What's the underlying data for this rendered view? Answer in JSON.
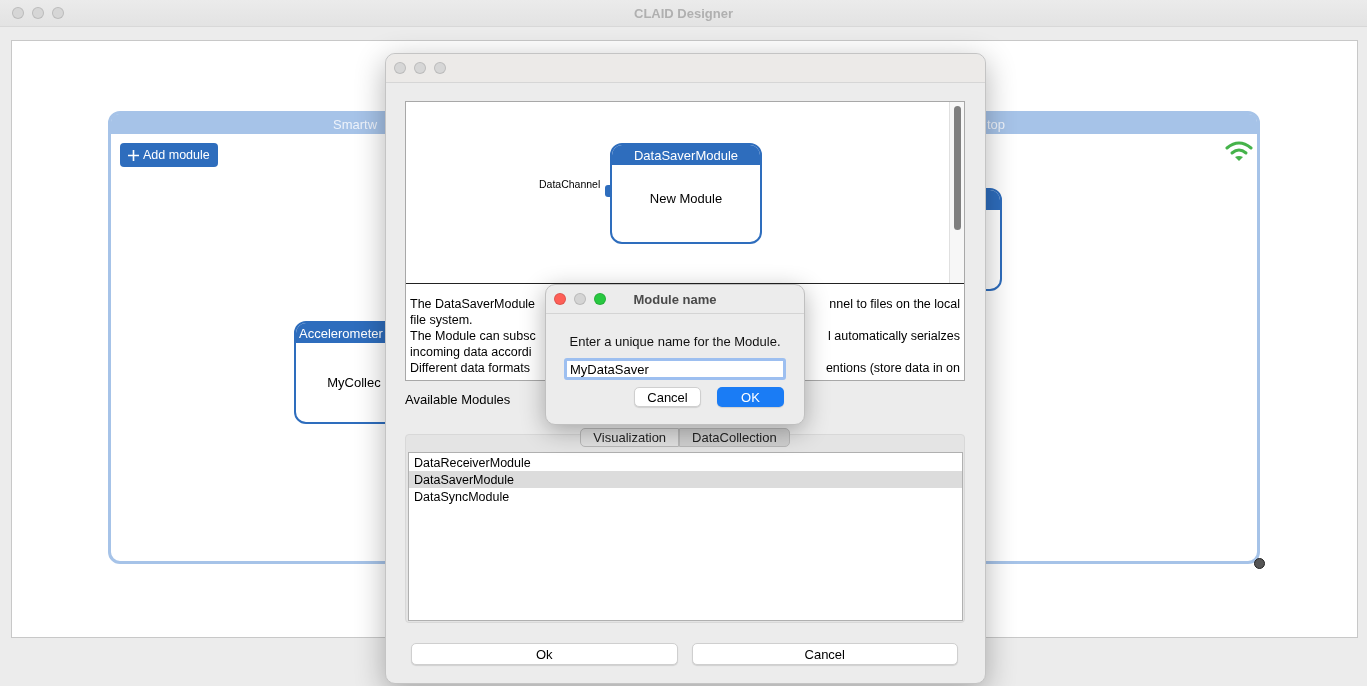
{
  "window": {
    "title": "CLAID Designer"
  },
  "canvas": {
    "group_titles": [
      "Smartw",
      "top"
    ],
    "add_button": "Add module",
    "modules": [
      {
        "title": "Accelerometer",
        "name": "MyCollec"
      }
    ]
  },
  "dialog": {
    "preview": {
      "module_title": "DataSaverModule",
      "module_name": "New Module",
      "channel": "DataChannel"
    },
    "description": [
      {
        "left": "The DataSaverModule",
        "right": "nnel to files on the local"
      },
      {
        "left": "file system."
      },
      {
        "left": "The Module can subsc",
        "right": "l automatically serialzes"
      },
      {
        "left": "incoming data accordi"
      },
      {
        "left": "Different data formats",
        "right": "entions (store data in on"
      }
    ],
    "available_label": "Available Modules",
    "tabs": [
      {
        "label": "Visualization",
        "selected": false
      },
      {
        "label": "DataCollection",
        "selected": true
      }
    ],
    "modules": [
      {
        "label": "DataReceiverModule",
        "selected": false
      },
      {
        "label": "DataSaverModule",
        "selected": true
      },
      {
        "label": "DataSyncModule",
        "selected": false
      }
    ],
    "buttons": [
      "Ok",
      "Cancel"
    ]
  },
  "prompt": {
    "title": "Module name",
    "message": "Enter a unique name for the Module.",
    "value": "MyDataSaver",
    "buttons": [
      {
        "label": "Cancel",
        "default": false
      },
      {
        "label": "OK",
        "default": true
      }
    ]
  }
}
